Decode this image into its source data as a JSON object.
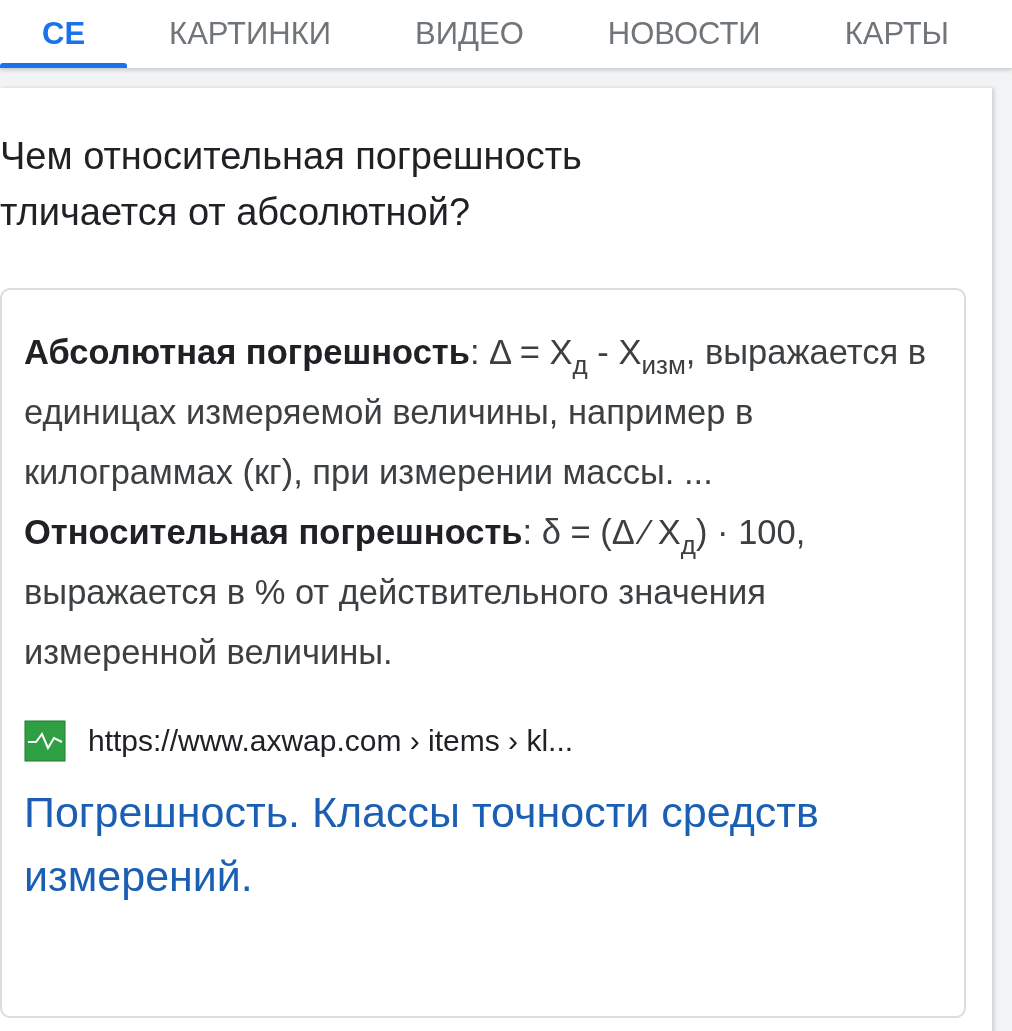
{
  "tabs": [
    {
      "label": "СЕ",
      "selected": true
    },
    {
      "label": "КАРТИНКИ",
      "selected": false
    },
    {
      "label": "ВИДЕО",
      "selected": false
    },
    {
      "label": "НОВОСТИ",
      "selected": false
    },
    {
      "label": "КАРТЫ",
      "selected": false
    }
  ],
  "question": {
    "lines": [
      "Чем относительная погрешность",
      "тличается от абсолютной?"
    ]
  },
  "snippet": {
    "text": "**Абсолютная погрешность**: Δ = X$_{д}$ - X$_{изм}$, выражается в единицах измеряемой величины, например в килограммах (кг), при измерении массы. ... **Относительная погрешность**: δ = (Δ ⁄ X$_{д}$) · 100, выражается в % от действительного значения измеренной величины.",
    "url": "https://www.axwap.com › items › kl...",
    "link": "Погрешность. Классы точности средств измерений."
  }
}
